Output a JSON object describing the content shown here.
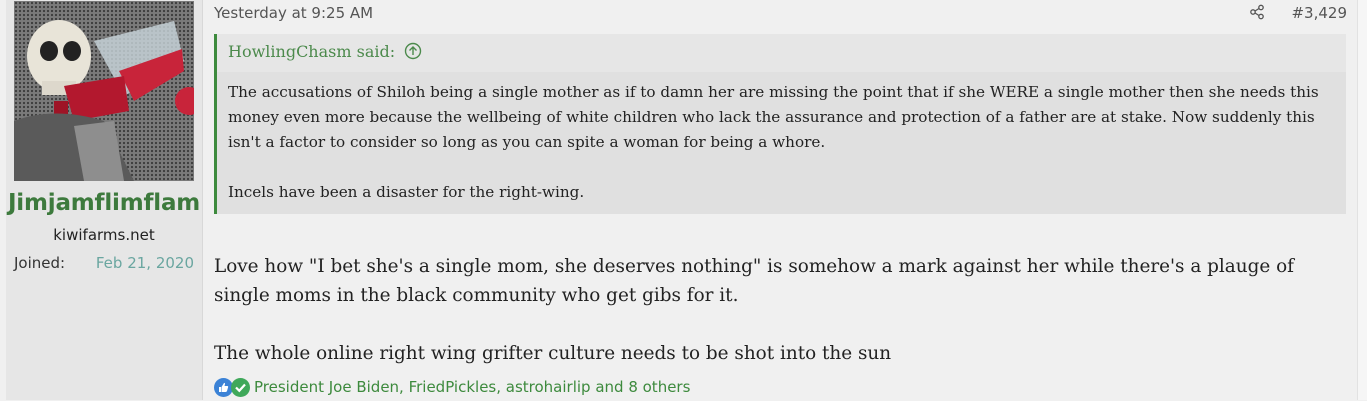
{
  "user": {
    "username": "Jimjamflimflam",
    "title": "kiwifarms.net",
    "joined_label": "Joined:",
    "joined_date": "Feb 21, 2020"
  },
  "post": {
    "date": "Yesterday at 9:25 AM",
    "number": "#3,429",
    "quote": {
      "author": "HowlingChasm said:",
      "paragraphs": [
        "The accusations of Shiloh being a single mother as if to damn her are missing the point that if she WERE a single mother then she needs this money even more because the wellbeing of white children who lack the assurance and protection of a father are at stake. Now suddenly this isn't a factor to consider so long as you can spite a woman for being a whore.",
        "Incels have been a disaster for the right-wing."
      ]
    },
    "body": [
      "Love how \"I bet she's a single mom, she deserves nothing\" is somehow a mark against her while there's a plauge of single moms in the black community who get gibs for it.",
      "The whole online right wing grifter culture needs to be shot into the sun"
    ],
    "reactions_text": "President Joe Biden, FriedPickles, astrohairlip and 8 others",
    "reaction_icons": [
      "like-icon",
      "agree-icon"
    ]
  },
  "colors": {
    "accent_green": "#3d8a3d",
    "username_green": "#3d7a3d",
    "joined_date": "#6aa6a0",
    "quote_bg": "#e0e0e0"
  }
}
